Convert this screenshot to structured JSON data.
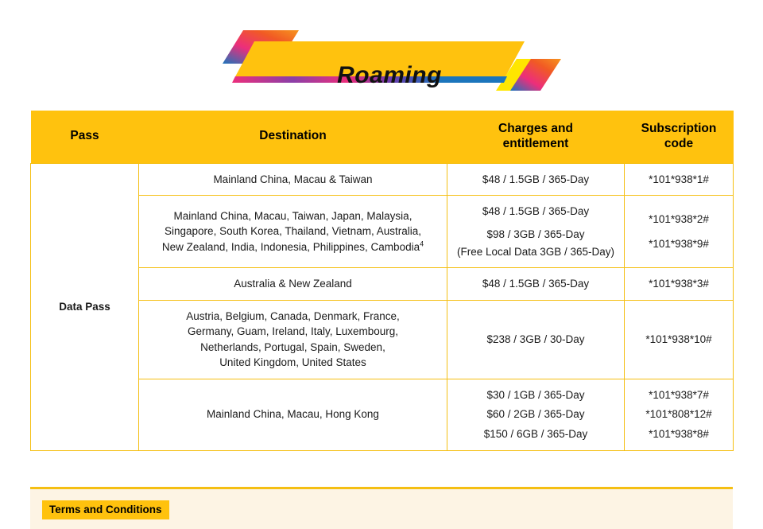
{
  "banner": {
    "title": "Roaming",
    "colors": {
      "yellow": "#FFC20E",
      "gradient_start": "#F7941E",
      "gradient_mid": "#EC2E7B",
      "gradient_end": "#1B75BC"
    }
  },
  "table": {
    "columns": [
      "Pass",
      "Destination",
      "Charges and entitlement",
      "Subscription code"
    ],
    "pass_label": "Data Pass",
    "rows": [
      {
        "destination_lines": [
          "Mainland China, Macau & Taiwan"
        ],
        "charges": [
          "$48 / 1.5GB / 365-Day"
        ],
        "codes": [
          "*101*938*1#"
        ]
      },
      {
        "destination_lines": [
          "Mainland China, Macau, Taiwan, Japan, Malaysia,",
          "Singapore, South Korea, Thailand, Vietnam, Australia,",
          "New Zealand, India, Indonesia, Philippines, Cambodia"
        ],
        "destination_superscript": "4",
        "charges": [
          "$48 / 1.5GB / 365-Day",
          "$98 / 3GB / 365-Day",
          "(Free Local Data 3GB / 365-Day)"
        ],
        "codes": [
          "*101*938*2#",
          "*101*938*9#"
        ]
      },
      {
        "destination_lines": [
          "Australia & New Zealand"
        ],
        "charges": [
          "$48 / 1.5GB / 365-Day"
        ],
        "codes": [
          "*101*938*3#"
        ]
      },
      {
        "destination_lines": [
          "Austria, Belgium, Canada, Denmark, France,",
          "Germany, Guam, Ireland, Italy, Luxembourg,",
          "Netherlands, Portugal, Spain, Sweden,",
          "United Kingdom, United States"
        ],
        "charges": [
          "$238 / 3GB / 30-Day"
        ],
        "codes": [
          "*101*938*10#"
        ]
      },
      {
        "destination_lines": [
          "Mainland China, Macau, Hong Kong"
        ],
        "charges": [
          "$30 / 1GB / 365-Day",
          "$60 / 2GB / 365-Day",
          "$150 / 6GB / 365-Day"
        ],
        "codes": [
          "*101*938*7#",
          "*101*808*12#",
          "*101*938*8#"
        ]
      }
    ]
  },
  "footer": {
    "terms_label": "Terms and Conditions",
    "band_color": "#FDF4E4"
  }
}
